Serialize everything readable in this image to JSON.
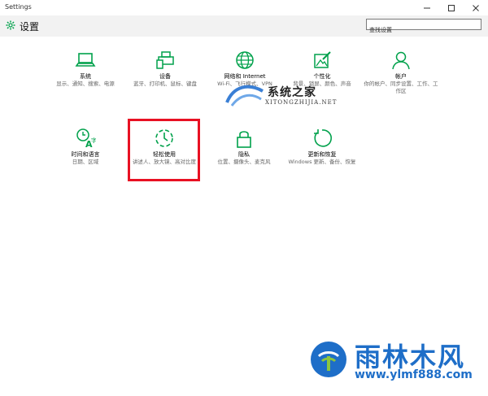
{
  "window": {
    "title": "Settings"
  },
  "header": {
    "title": "设置"
  },
  "search": {
    "placeholder": "查找设置"
  },
  "tiles": [
    {
      "name": "系统",
      "desc": "显示、通知、搜索、电源",
      "icon": "laptop-icon"
    },
    {
      "name": "设备",
      "desc": "蓝牙、打印机、鼠标、键盘",
      "icon": "devices-icon"
    },
    {
      "name": "网络和 Internet",
      "desc": "Wi-Fi、飞行模式、VPN",
      "icon": "globe-icon"
    },
    {
      "name": "个性化",
      "desc": "背景、锁屏、颜色、声音",
      "icon": "personalization-icon"
    },
    {
      "name": "帐户",
      "desc": "你的帐户、同步设置、工作、工作区",
      "icon": "account-icon"
    },
    {
      "name": "时间和语言",
      "desc": "日期、区域",
      "icon": "time-language-icon"
    },
    {
      "name": "轻松使用",
      "desc": "讲述人、放大镜、高对比度",
      "icon": "ease-of-access-icon"
    },
    {
      "name": "隐私",
      "desc": "位置、摄像头、麦克风",
      "icon": "lock-icon"
    },
    {
      "name": "更新和恢复",
      "desc": "Windows 更新、备份、恢复",
      "icon": "update-icon"
    }
  ],
  "watermark": {
    "text": "系统之家",
    "subtext": "XITONGZHIJIA.NET"
  },
  "brand": {
    "text": "雨林木风",
    "url": "www.ylmf888.com"
  },
  "colors": {
    "accent": "#00a14b",
    "highlight": "#e81123",
    "brand": "#1e6ec8"
  }
}
